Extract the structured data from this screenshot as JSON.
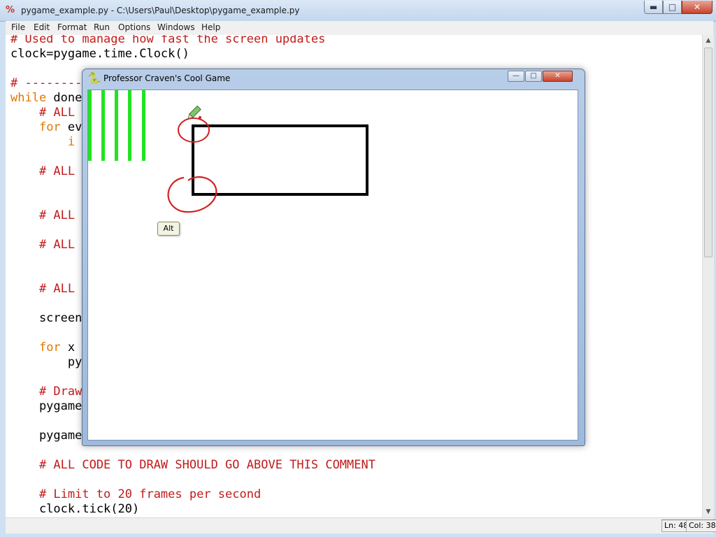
{
  "editor": {
    "app_icon": "%",
    "title": "pygame_example.py - C:\\Users\\Paul\\Desktop\\pygame_example.py",
    "window_buttons": {
      "minimize": "▬",
      "maximize": "□",
      "close": "✕"
    },
    "menu": [
      "File",
      "Edit",
      "Format",
      "Run",
      "Options",
      "Windows",
      "Help"
    ],
    "code_lines": [
      {
        "text": "# Used to manage how fast the screen updates",
        "style": "comment"
      },
      {
        "text": "clock=pygame.time.Clock()",
        "style": "plain"
      },
      {
        "text": "# --------",
        "style": "comment"
      },
      {
        "text": "while done",
        "style": "mixed_kw"
      },
      {
        "text": "    # ALL",
        "style": "comment"
      },
      {
        "text": "    for ev",
        "style": "mixed_kw"
      },
      {
        "text": "        i",
        "style": "kw"
      },
      {
        "text": "    # ALL",
        "style": "comment"
      },
      {
        "text": "    # ALL",
        "style": "comment"
      },
      {
        "text": "    # ALL",
        "style": "comment"
      },
      {
        "text": "    # ALL",
        "style": "comment"
      },
      {
        "text": "    screen",
        "style": "plain"
      },
      {
        "text": "    for x",
        "style": "mixed_kw"
      },
      {
        "text": "        py",
        "style": "plain"
      },
      {
        "text": "    # Draw",
        "style": "comment"
      },
      {
        "text": "    pygame",
        "style": "plain"
      },
      {
        "text": "    pygame",
        "style": "plain"
      },
      {
        "text": "    # ALL CODE TO DRAW SHOULD GO ABOVE THIS COMMENT",
        "style": "comment"
      },
      {
        "text": "    # Limit to 20 frames per second",
        "style": "comment"
      },
      {
        "text": "    clock.tick(20)",
        "style": "plain"
      }
    ],
    "status": {
      "line": "Ln: 48",
      "column": "Col: 38"
    },
    "scrollbar": {
      "up_arrow": "▲",
      "down_arrow": "▼"
    }
  },
  "game_window": {
    "icon": "snake-icon",
    "icon_glyph": "🐍",
    "title": "Professor Craven's Cool Game",
    "buttons": {
      "minimize": "—",
      "maximize": "□",
      "close": "✕"
    },
    "canvas_background": "#ffffff",
    "green_bar_count": 5,
    "green_color": "#22e222",
    "rect_color": "#000000",
    "annotation_color": "#d42020",
    "tooltip": "Alt"
  }
}
